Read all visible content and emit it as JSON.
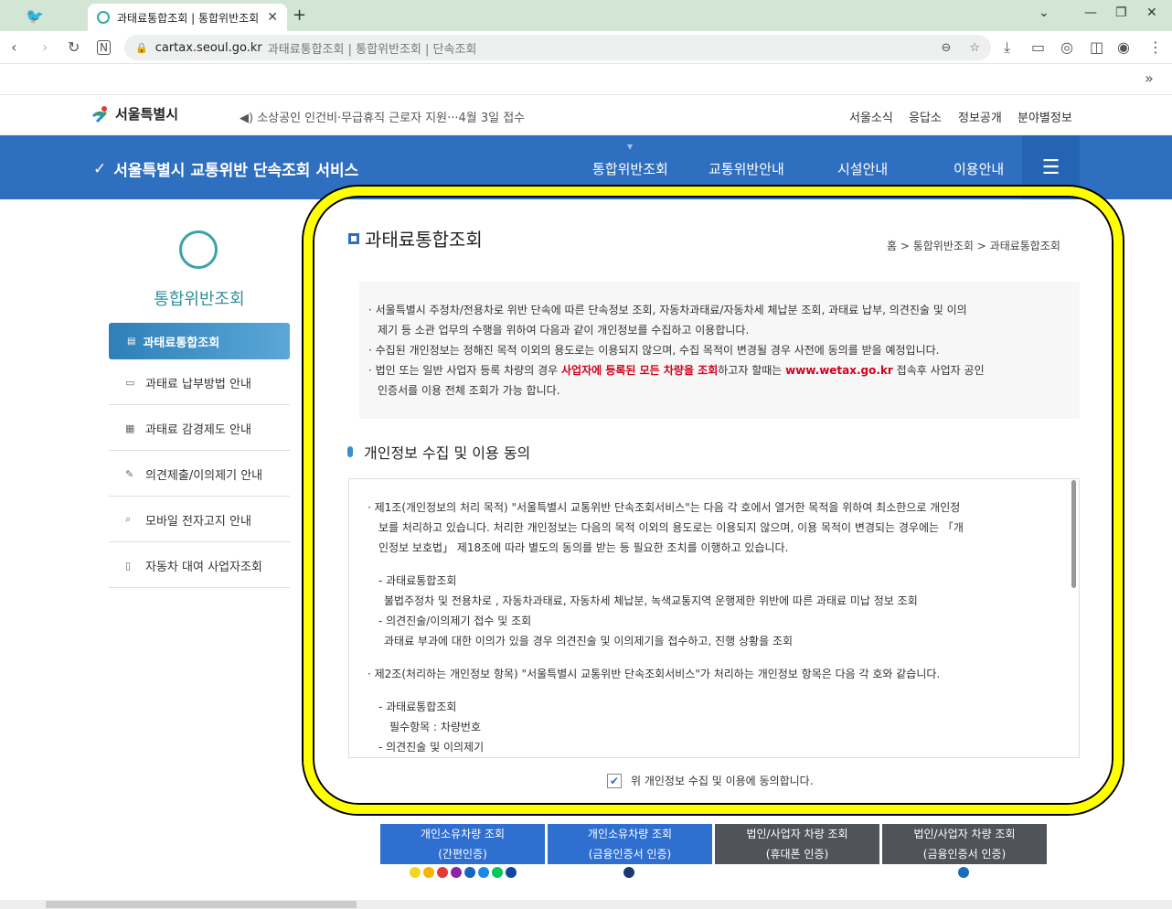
{
  "browser": {
    "tab_title": "과태료통합조회 | 통합위반조회",
    "url_host": "cartax.seoul.go.kr",
    "url_rest": "과태료통합조회 | 통합위반조회 | 단속조회",
    "new_tab": "+",
    "bookmarks_more": "»"
  },
  "header": {
    "logo_text": "서울특별시",
    "notice": "◀) 소상공인 인건비·무급휴직 근로자 지원···4월 3일 접수",
    "util_links": [
      "서울소식",
      "응답소",
      "정보공개",
      "분야별정보"
    ]
  },
  "service": {
    "title": "서울특별시 교통위반 단속조회 서비스",
    "nav": [
      "통합위반조회",
      "교통위반안내",
      "시설안내",
      "이용안내"
    ],
    "menu_icon": "hamburger-icon"
  },
  "sidebar": {
    "title": "통합위반조회",
    "active": "과태료통합조회",
    "items": [
      "과태료 납부방법 안내",
      "과태료 감경제도 안내",
      "의견제출/이의제기 안내",
      "모바일 전자고지 안내",
      "자동차 대여 사업자조회"
    ]
  },
  "content": {
    "title": "과태료통합조회",
    "breadcrumb": "홈 > 통합위반조회 > 과태료통합조회",
    "info": {
      "line1": "· 서울특별시 주정차/전용차로 위반 단속에 따른 단속정보 조회, 자동차과태료/자동차세 체납분 조회, 과태료 납부, 의견진술 및 이의",
      "line1b": "제기 등 소관 업무의 수행을 위하여 다음과 같이 개인정보를 수집하고 이용합니다.",
      "line2": "· 수집된 개인정보는 정해진 목적 이외의 용도로는 이용되지 않으며, 수집 목적이 변경될 경우 사전에 동의를 받을 예정입니다.",
      "line3_pre": "· 법인 또는 일반 사업자 등록 차량의 경우 ",
      "line3_red": "사업자에 등록된 모든 차량을 조회",
      "line3_mid": "하고자 할때는 ",
      "line3_link": "www.wetax.go.kr",
      "line3_post": " 접속후 사업자 공인",
      "line3b": "인증서를 이용 전체 조회가 가능 합니다."
    },
    "section_title": "개인정보 수집 및 이용 동의",
    "terms": {
      "art1": "· 제1조(개인정보의 처리 목적) \"서울특별시 교통위반 단속조회서비스\"는 다음 각 호에서 열거한 목적을 위하여 최소한으로 개인정",
      "art1b": "보를 처리하고 있습니다. 처리한 개인정보는 다음의 목적 이외의 용도로는 이용되지 않으며, 이용 목적이 변경되는 경우에는 「개",
      "art1c": "인정보 보호법」 제18조에 따라 별도의 동의를 받는 등 필요한 조치를 이행하고 있습니다.",
      "sub1": "- 과태료통합조회",
      "sub1b": "불법주정차 및 전용차로 , 자동차과태료, 자동차세 체납분, 녹색교통지역 운행제한 위반에 따른 과태료 미납 정보 조회",
      "sub2": "- 의견진술/이의제기 접수 및 조회",
      "sub2b": "과태료 부과에 대한 이의가 있을 경우 의견진술 및 이의제기을 접수하고, 진행 상황을 조회",
      "art2": "· 제2조(처리하는 개인정보 항목) \"서울특별시 교통위반 단속조회서비스\"가 처리하는 개인정보 항목은 다음 각 호와 같습니다.",
      "sub3": "- 과태료통합조회",
      "sub3b": "필수항목 : 차량번호",
      "sub4": "- 의견진술 및 이의제기"
    },
    "agree_label": "위 개인정보 수집 및 이용에 동의합니다."
  },
  "buttons": [
    {
      "l1": "개인소유차량 조회",
      "l2": "(간편인증)"
    },
    {
      "l1": "개인소유차량 조회",
      "l2": "(금융인증서 인증)"
    },
    {
      "l1": "법인/사업자 차량 조회",
      "l2": "(휴대폰 인증)"
    },
    {
      "l1": "법인/사업자 차량 조회",
      "l2": "(금융인증서 인증)"
    }
  ],
  "colors": {
    "accent": "#2f6fbf",
    "highlight": "#ffff00",
    "red": "#d0021b"
  }
}
